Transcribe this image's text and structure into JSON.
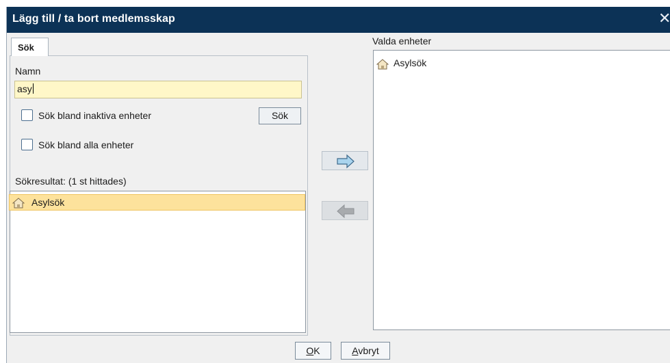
{
  "dialog": {
    "title": "Lägg till / ta bort medlemsskap",
    "close_glyph": "✕"
  },
  "search_tab": {
    "label": "Sök"
  },
  "name_field": {
    "label": "Namn",
    "value": "asy"
  },
  "checkboxes": [
    {
      "label": "Sök bland inaktiva enheter",
      "checked": false
    },
    {
      "label": "Sök bland alla enheter",
      "checked": false
    }
  ],
  "search_button": {
    "label": "Sök"
  },
  "results": {
    "label": "Sökresultat: (1 st hittades)",
    "items": [
      {
        "label": "Asylsök",
        "icon": "house-icon",
        "selected": true
      }
    ]
  },
  "selected_units": {
    "label": "Valda enheter",
    "items": [
      {
        "label": "Asylsök",
        "icon": "house-icon"
      }
    ]
  },
  "transfer_buttons": {
    "add_icon": "arrow-right-icon",
    "remove_icon": "arrow-left-icon"
  },
  "footer": {
    "ok_mnemonic": "O",
    "ok_rest": "K",
    "cancel_mnemonic": "A",
    "cancel_rest": "vbryt"
  },
  "colors": {
    "titlebar": "#0c3256",
    "input_bg": "#fff7c8",
    "selection": "#fde29c",
    "arrow_blue": "#a9d4ee"
  }
}
